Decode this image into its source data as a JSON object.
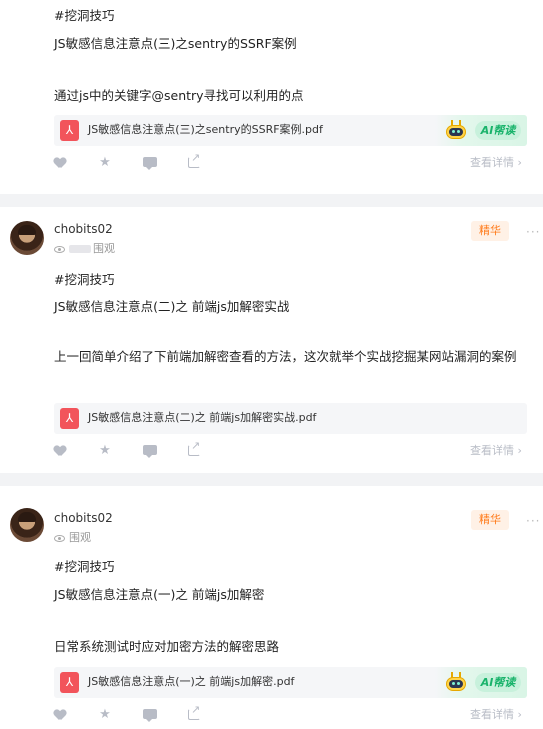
{
  "posts": [
    {
      "tag": "#挖洞技巧",
      "title": "JS敏感信息注意点(三)之sentry的SSRF案例",
      "body": "通过js中的关键字@sentry寻找可以利用的点",
      "attachment": {
        "name": "JS敏感信息注意点(三)之sentry的SSRF案例.pdf",
        "ai_label": "AI帮读"
      },
      "actions": {
        "detail_label": "查看详情 ›"
      }
    },
    {
      "username": "chobits02",
      "views_label": "围观",
      "badge": "精华",
      "more": "···",
      "tag": "#挖洞技巧",
      "title": "JS敏感信息注意点(二)之 前端js加解密实战",
      "body": "上一回简单介绍了下前端加解密查看的方法，这次就举个实战挖掘某网站漏洞的案例",
      "attachment": {
        "name": "JS敏感信息注意点(二)之 前端js加解密实战.pdf"
      },
      "actions": {
        "detail_label": "查看详情 ›"
      }
    },
    {
      "username": "chobits02",
      "views_label": "围观",
      "badge": "精华",
      "more": "···",
      "tag": "#挖洞技巧",
      "title": "JS敏感信息注意点(一)之 前端js加解密",
      "body": "日常系统测试时应对加密方法的解密思路",
      "attachment": {
        "name": "JS敏感信息注意点(一)之 前端js加解密.pdf",
        "ai_label": "AI帮读"
      },
      "actions": {
        "detail_label": "查看详情 ›"
      }
    }
  ],
  "colors": {
    "badge_text": "#ff7a1a",
    "badge_bg": "#fff1e6",
    "ai_green": "#19b36b",
    "pdf_red": "#f2545b"
  },
  "icons": [
    "heart-icon",
    "star-icon",
    "comment-icon",
    "share-icon",
    "eye-icon",
    "pdf-icon",
    "robot-icon",
    "more-icon"
  ]
}
